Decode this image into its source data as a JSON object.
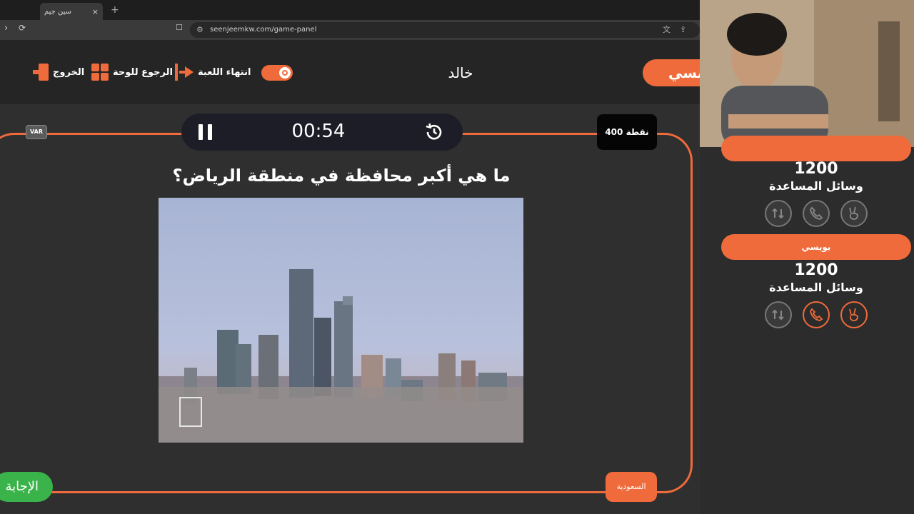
{
  "browser": {
    "tab_title": "سين جيم",
    "tab_close": "×",
    "new_tab": "+",
    "url": "seenjeemkw.com/game-panel"
  },
  "header": {
    "exit_label": "الخروج",
    "back_label": "الرجوع للوحة",
    "end_label": "انتهاء اللعبة",
    "current_team": "خالد",
    "active_team_pill": "يبسي"
  },
  "board": {
    "var_label": "VAR",
    "timer": "00:54",
    "points": "400 نقطة",
    "question": "ما هي أكبر محافظة في منطقة الرياض؟",
    "answer_button": "الإجابة",
    "country": "السعودية"
  },
  "teams": [
    {
      "name": "",
      "score": "1200",
      "aids_label": "وسائل المساعدة",
      "aids": [
        {
          "icon": "swap-icon",
          "active": false
        },
        {
          "icon": "phone-icon",
          "active": false
        },
        {
          "icon": "peace-hand-icon",
          "active": false
        }
      ]
    },
    {
      "name": "يويسي",
      "score": "1200",
      "aids_label": "وسائل المساعدة",
      "aids": [
        {
          "icon": "swap-icon",
          "active": false
        },
        {
          "icon": "phone-icon",
          "active": true
        },
        {
          "icon": "peace-hand-icon",
          "active": true
        }
      ]
    }
  ],
  "colors": {
    "accent": "#ef6b3b",
    "answer_green": "#3ab34a",
    "background": "#2f2f2f"
  }
}
